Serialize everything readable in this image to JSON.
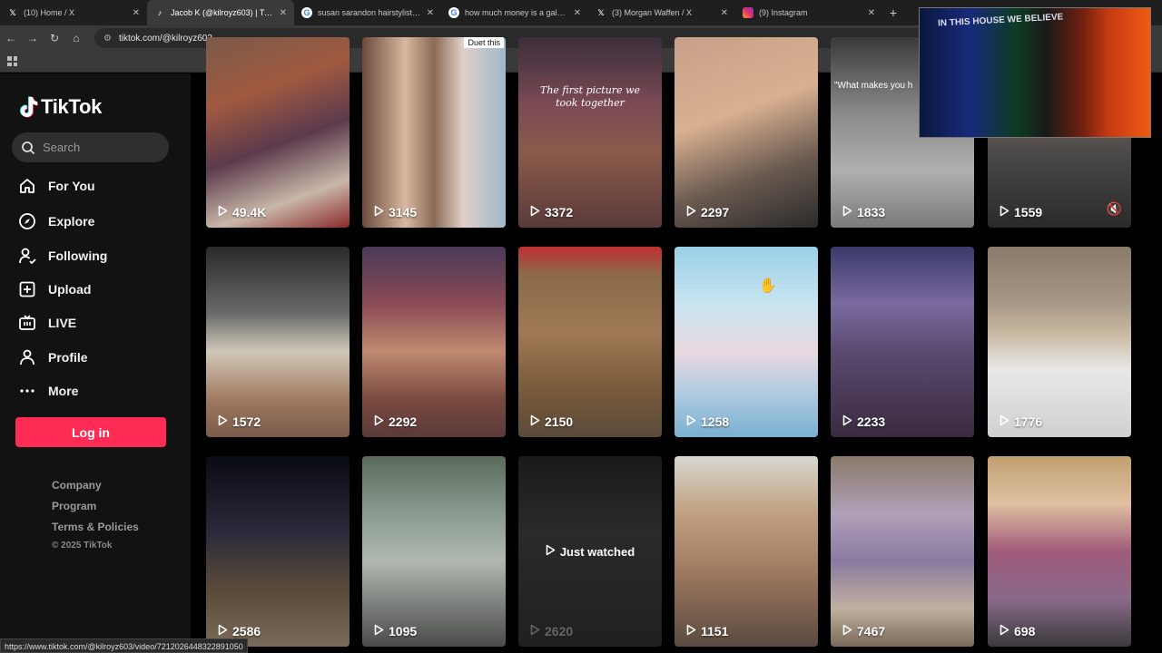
{
  "browser": {
    "tabs": [
      {
        "title": "(10) Home / X",
        "favicon": "X",
        "active": false
      },
      {
        "title": "Jacob K (@kilroyz603) | TikTok",
        "favicon": "tiktok",
        "active": true
      },
      {
        "title": "susan sarandon hairstylist - Go",
        "favicon": "G",
        "active": false
      },
      {
        "title": "how much money is a galaxy o",
        "favicon": "G",
        "active": false
      },
      {
        "title": "(3) Morgan Waffen / X",
        "favicon": "X",
        "active": false
      },
      {
        "title": "(9) Instagram",
        "favicon": "instagram",
        "active": false
      }
    ],
    "url": "tiktok.com/@kilroyz603",
    "status_url": "https://www.tiktok.com/@kilroyz603/video/7212026448322891050"
  },
  "sidebar": {
    "logo": "TikTok",
    "search_placeholder": "Search",
    "nav": [
      {
        "label": "For You",
        "icon": "home-icon"
      },
      {
        "label": "Explore",
        "icon": "compass-icon"
      },
      {
        "label": "Following",
        "icon": "following-icon"
      },
      {
        "label": "Upload",
        "icon": "upload-icon"
      },
      {
        "label": "LIVE",
        "icon": "live-icon"
      },
      {
        "label": "Profile",
        "icon": "profile-icon"
      },
      {
        "label": "More",
        "icon": "more-icon"
      }
    ],
    "login_label": "Log in",
    "footer": [
      "Company",
      "Program",
      "Terms & Policies"
    ],
    "copyright": "© 2025 TikTok"
  },
  "videos": [
    {
      "views": "49.4K",
      "bg": "linear-gradient(160deg,#7a5a4a 0%,#a0593f 30%,#5c3a4d 55%,#c9b7a8 80%,#8a2a2a 100%)"
    },
    {
      "views": "3145",
      "bg": "linear-gradient(90deg,#6b4a3a 0%,#d9b8a0 30%,#8a6a55 50%,#e0d0c8 70%,#9fb8c8 100%)",
      "duet": "Duet this"
    },
    {
      "views": "3372",
      "bg": "linear-gradient(180deg,#3a2e3a 0%,#7b4a55 35%,#8a5a4a 60%,#5a3a3a 100%)",
      "caption": "The first picture we took together"
    },
    {
      "views": "2297",
      "bg": "linear-gradient(160deg,#c8a088 0%,#d9b090 40%,#6a5a50 70%,#2a2a2a 100%)"
    },
    {
      "views": "1833",
      "bg": "linear-gradient(180deg,#3a3a3a 0%,#8a8a8a 40%,#b0b0b0 70%,#7a7a7a 100%)",
      "quote": "\"What makes you h"
    },
    {
      "views": "1559",
      "bg": "linear-gradient(180deg,#e07a20 0%,#8a6a5a 30%,#4a4a4a 60%,#2a2a2a 100%)",
      "muted": true
    },
    {
      "views": "1572",
      "bg": "linear-gradient(180deg,#2a2a2a 0%,#6a6a6a 35%,#d0c8b8 55%,#a07a60 80%,#7a5a4a 100%)"
    },
    {
      "views": "2292",
      "bg": "linear-gradient(180deg,#4a3a5a 0%,#8a4a55 30%,#c08a70 55%,#7a4a40 80%,#5a3a3a 100%)"
    },
    {
      "views": "2150",
      "bg": "linear-gradient(180deg,#c03030 0%,#8a6a4a 15%,#a07a55 45%,#7a5a3a 75%,#5a4a3a 100%)"
    },
    {
      "views": "1258",
      "bg": "linear-gradient(180deg,#9ad0e8 0%,#c8e4f0 30%,#e8d8e0 55%,#a8c8e0 80%,#7ab0d0 100%)"
    },
    {
      "views": "2233",
      "bg": "linear-gradient(180deg,#3a3a6a 0%,#7a6aa0 30%,#5a4a70 55%,#3a2a40 100%)"
    },
    {
      "views": "1776",
      "bg": "linear-gradient(180deg,#8a7a6a 0%,#a89888 30%,#c8b8a0 45%,#e8e8e8 65%,#d0d0d0 100%)"
    },
    {
      "views": "2586",
      "bg": "linear-gradient(180deg,#0a0a14 0%,#2a2a3a 40%,#5a4a3a 70%,#7a6a5a 100%)"
    },
    {
      "views": "1095",
      "bg": "linear-gradient(180deg,#5a6a5a 0%,#8a9a90 30%,#b0b8b0 55%,#4a4a4a 100%)"
    },
    {
      "views": "2620",
      "bg": "linear-gradient(180deg,#1a1a1a 0%,#2a2a2a 40%,#202020 100%)",
      "watched": "Just watched",
      "dim": true
    },
    {
      "views": "1151",
      "bg": "linear-gradient(180deg,#d8d8d0 0%,#c0a080 30%,#a07a60 60%,#5a4a40 100%)"
    },
    {
      "views": "7467",
      "bg": "linear-gradient(180deg,#8a7a6a 0%,#b0a0b8 30%,#8a7aa0 55%,#c0b0a0 80%,#7a6a5a 100%)"
    },
    {
      "views": "698",
      "bg": "linear-gradient(180deg,#c0a070 0%,#e0c0a0 25%,#a05a7a 50%,#8a6a8a 75%,#3a3a3a 100%)"
    }
  ],
  "webcam_text": "IN THIS HOUSE WE BELIEVE"
}
